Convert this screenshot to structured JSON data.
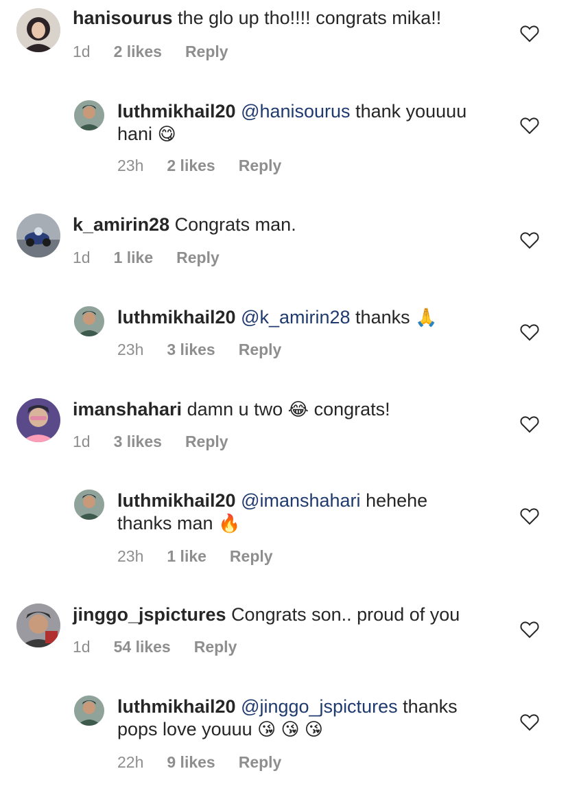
{
  "comments": [
    {
      "username": "hanisourus",
      "text": "the glo up tho!!!! congrats mika!!",
      "time": "1d",
      "likes": "2 likes",
      "reply_label": "Reply",
      "avatar_color": "#6b4a3e"
    },
    {
      "username": "luthmikhail20",
      "mention": "@hanisourus",
      "text_line1": "thank youuuu",
      "text_line2": "hani",
      "emoji": "😋",
      "time": "23h",
      "likes": "2 likes",
      "reply_label": "Reply",
      "avatar_color": "#3e5a4c"
    },
    {
      "username": "k_amirin28",
      "text": "Congrats man.",
      "time": "1d",
      "likes": "1 like",
      "reply_label": "Reply",
      "avatar_color": "#2f3f58"
    },
    {
      "username": "luthmikhail20",
      "mention": "@k_amirin28",
      "text": "thanks",
      "emoji": "🙏",
      "time": "23h",
      "likes": "3 likes",
      "reply_label": "Reply",
      "avatar_color": "#3e5a4c"
    },
    {
      "username": "imanshahari",
      "text_before": "damn u two",
      "emoji": "😂",
      "text_after": "congrats!",
      "time": "1d",
      "likes": "3 likes",
      "reply_label": "Reply",
      "avatar_color": "#6a4f8c"
    },
    {
      "username": "luthmikhail20",
      "mention": "@imanshahari",
      "text_line1": "hehehe",
      "text_line2": "thanks man",
      "emoji": "🔥",
      "time": "23h",
      "likes": "1 like",
      "reply_label": "Reply",
      "avatar_color": "#3e5a4c"
    },
    {
      "username": "jinggo_jspictures",
      "text": "Congrats son.. proud of you",
      "time": "1d",
      "likes": "54 likes",
      "reply_label": "Reply",
      "avatar_color": "#4a4a4a"
    },
    {
      "username": "luthmikhail20",
      "mention": "@jinggo_jspictures",
      "text_line1": "thanks",
      "text_line2": "pops love youuu",
      "emoji": "😘 😘 😘",
      "time": "22h",
      "likes": "9 likes",
      "reply_label": "Reply",
      "avatar_color": "#3e5a4c"
    }
  ],
  "icons": {
    "like": "heart-outline-icon"
  }
}
